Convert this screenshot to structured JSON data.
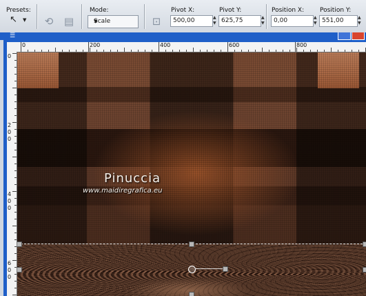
{
  "toolbar": {
    "presets_label": "Presets:",
    "mode_label": "Mode:",
    "mode_value": "Scale",
    "pivot_x_label": "Pivot X:",
    "pivot_x_value": "500,00",
    "pivot_y_label": "Pivot Y:",
    "pivot_y_value": "625,75",
    "position_x_label": "Position X:",
    "position_x_value": "0,00",
    "position_y_label": "Position Y:",
    "position_y_value": "551,00"
  },
  "ruler": {
    "top_labels": [
      "0",
      "200",
      "400",
      "600",
      "800"
    ],
    "left_labels": [
      "0",
      "2",
      "0",
      "0",
      "4",
      "0",
      "0",
      "6",
      "0",
      "0"
    ]
  },
  "canvas": {
    "watermark_name": "Pinuccia",
    "watermark_url": "www.maidiregrafica.eu"
  },
  "colors": {
    "title_bar": "#1f5fc8",
    "canvas_accent": "#a85a2d"
  }
}
